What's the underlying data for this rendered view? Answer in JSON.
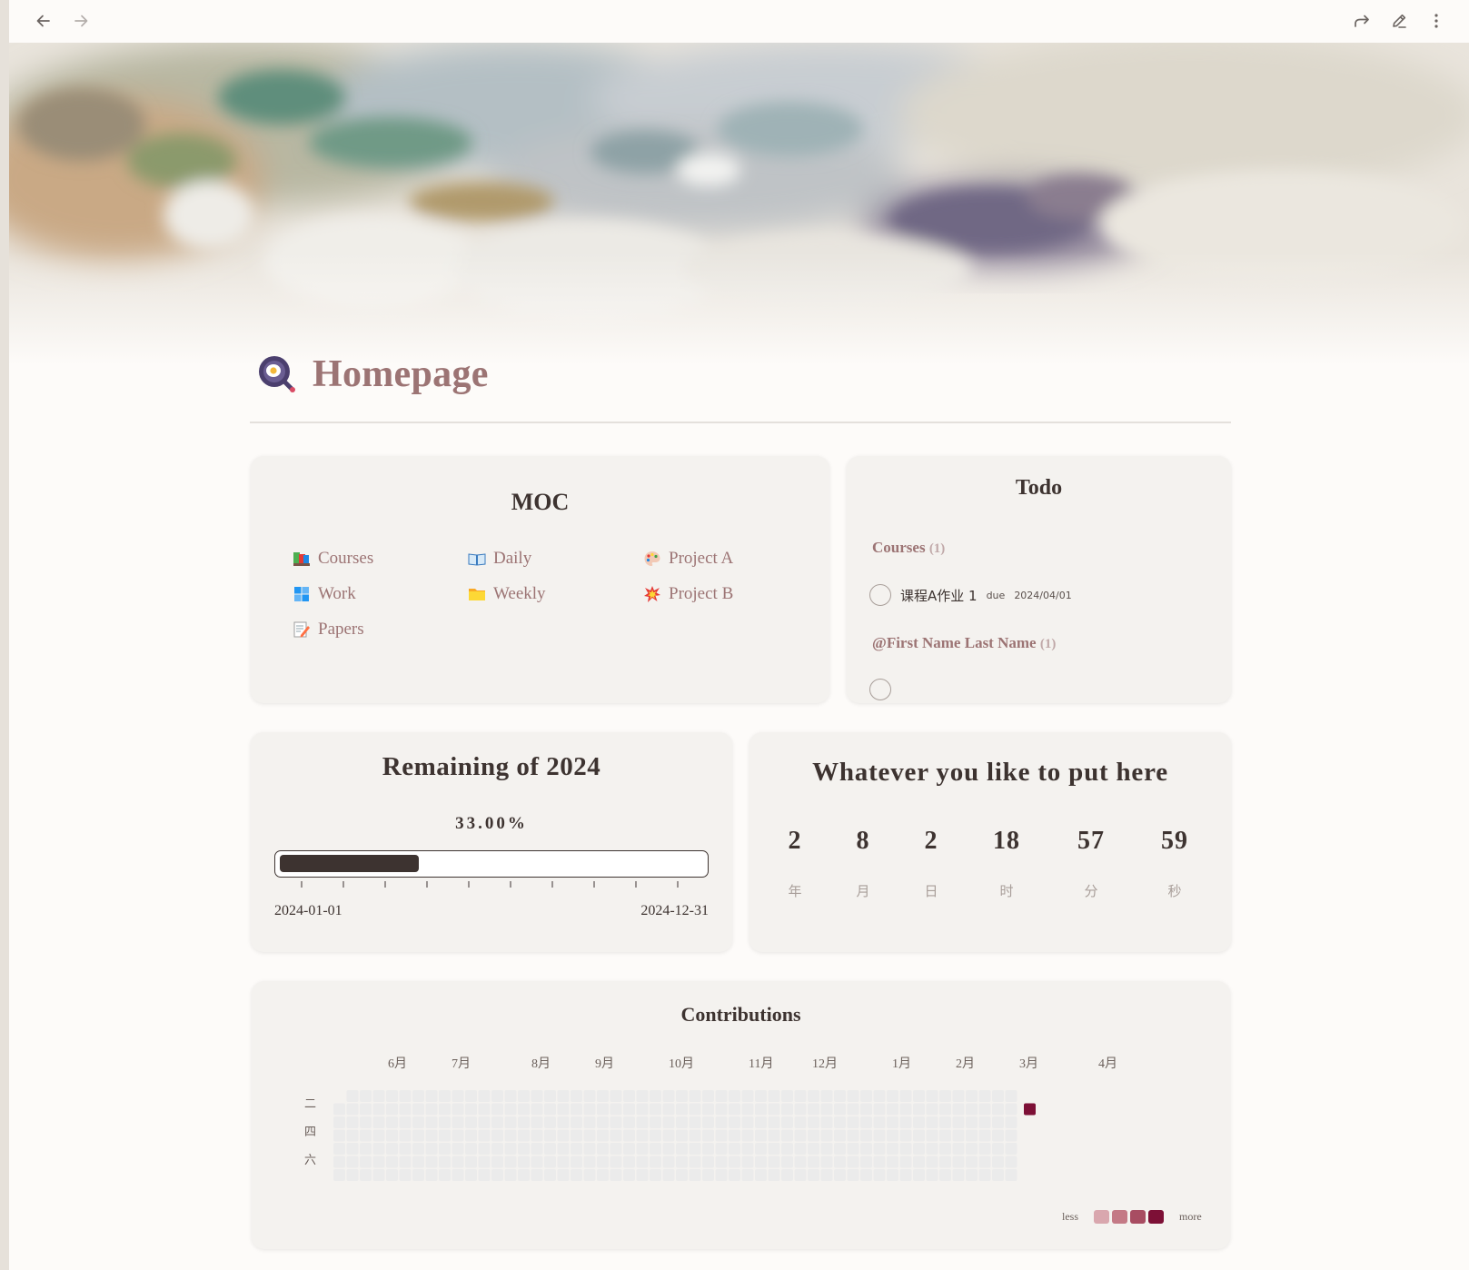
{
  "toolbar": {
    "back_icon": "arrow-left-icon",
    "forward_icon": "arrow-right-icon",
    "share_icon": "share-arrow-icon",
    "edit_icon": "pencil-icon",
    "more_icon": "more-vertical-icon"
  },
  "page": {
    "title": "Homepage",
    "icon": "frying-pan-egg-icon"
  },
  "moc": {
    "title": "MOC",
    "items": [
      {
        "label": "Courses",
        "icon": "books-icon"
      },
      {
        "label": "Daily",
        "icon": "open-book-icon"
      },
      {
        "label": "Project A",
        "icon": "palette-icon"
      },
      {
        "label": "Work",
        "icon": "windows-icon"
      },
      {
        "label": "Weekly",
        "icon": "folder-icon"
      },
      {
        "label": "Project B",
        "icon": "explosion-icon"
      },
      {
        "label": "Papers",
        "icon": "memo-icon"
      }
    ]
  },
  "todo": {
    "title": "Todo",
    "groups": [
      {
        "name": "Courses",
        "count": "(1)",
        "items": [
          {
            "text": "课程A作业 1",
            "due_label": "due",
            "due_date": "2024/04/01"
          }
        ]
      },
      {
        "name": "@First Name Last Name",
        "count": "(1)",
        "items": []
      }
    ]
  },
  "progress": {
    "title": "Remaining of 2024",
    "percent_text": "33.00%",
    "fraction": 0.33,
    "start_label": "2024-01-01",
    "end_label": "2024-12-31"
  },
  "countdown": {
    "title": "Whatever you like to put here",
    "units": [
      {
        "value": "2",
        "label": "年"
      },
      {
        "value": "8",
        "label": "月"
      },
      {
        "value": "2",
        "label": "日"
      },
      {
        "value": "18",
        "label": "时"
      },
      {
        "value": "57",
        "label": "分"
      },
      {
        "value": "59",
        "label": "秒"
      }
    ]
  },
  "contributions": {
    "title": "Contributions",
    "months": [
      "6月",
      "7月",
      "8月",
      "9月",
      "10月",
      "11月",
      "12月",
      "1月",
      "2月",
      "3月",
      "4月"
    ],
    "day_labels": [
      "二",
      "四",
      "六"
    ],
    "legend_less": "less",
    "legend_more": "more",
    "colors": {
      "empty": "#ebebeb",
      "levels": [
        "#d9a7ae",
        "#c47a86",
        "#a84d62",
        "#7d1036"
      ]
    },
    "active_cell": {
      "week": 52,
      "day": 1,
      "level": 4
    }
  }
}
